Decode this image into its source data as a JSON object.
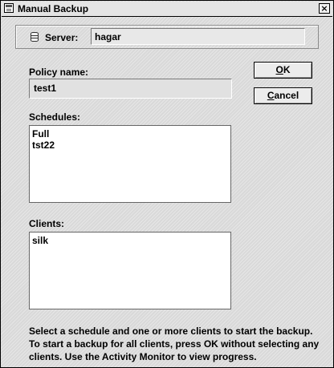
{
  "window": {
    "title": "Manual Backup",
    "close_glyph": "×"
  },
  "server": {
    "label": "Server:",
    "value": "hagar",
    "icon": "database-icon"
  },
  "policy": {
    "label": "Policy name:",
    "value": "test1"
  },
  "buttons": {
    "ok": {
      "mnemonic": "O",
      "rest": "K"
    },
    "cancel": {
      "mnemonic": "C",
      "rest": "ancel"
    }
  },
  "schedules": {
    "label": "Schedules:",
    "items": [
      "Full",
      "tst22"
    ]
  },
  "clients": {
    "label": "Clients:",
    "items": [
      "silk"
    ]
  },
  "help_text": "Select a schedule and one or more clients to start the backup. To start a backup for all clients, press OK without selecting any clients. Use the Activity Monitor to view progress."
}
